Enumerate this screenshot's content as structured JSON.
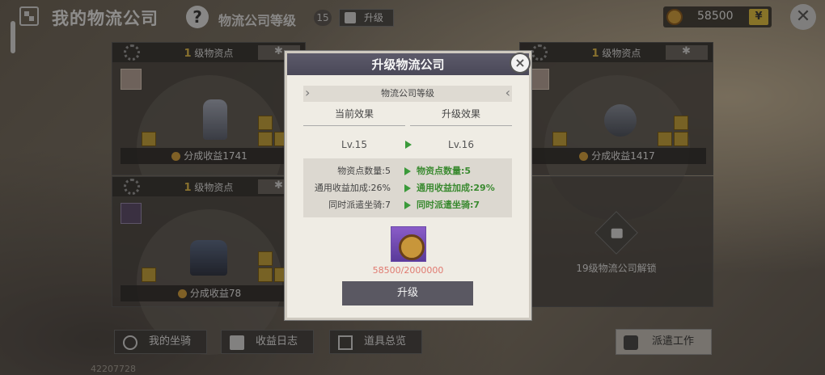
{
  "header": {
    "title": "我的物流公司",
    "help": "?",
    "level_label": "物流公司等级",
    "level_value": "15",
    "upgrade_label": "升级"
  },
  "currency": {
    "amount": "58500",
    "cart": "🛒"
  },
  "cards": [
    {
      "level_num": "1",
      "level_text": "级物资点",
      "earnings": "分成收益1741"
    },
    {
      "level_num": "1",
      "level_text": "级物资点",
      "earnings": "分成收益1417"
    },
    {
      "level_num": "1",
      "level_text": "级物资点",
      "earnings": "分成收益78"
    }
  ],
  "locked_slot": {
    "text": "19级物流公司解锁"
  },
  "bottom": {
    "mounts": "我的坐骑",
    "log": "收益日志",
    "items": "道具总览",
    "dispatch": "派遣工作",
    "uid": "42207728"
  },
  "modal": {
    "title": "升级物流公司",
    "close": "×",
    "section": "物流公司等级",
    "current_header": "当前效果",
    "upgrade_header": "升级效果",
    "current_level": "Lv.15",
    "next_level": "Lv.16",
    "stats": [
      {
        "current": "物资点数量:5",
        "next": "物资点数量:5"
      },
      {
        "current": "通用收益加成:26%",
        "next": "通用收益加成:29%"
      },
      {
        "current": "同时派遣坐骑:7",
        "next": "同时派遣坐骑:7"
      }
    ],
    "cost": "58500/2000000",
    "button": "升级"
  }
}
